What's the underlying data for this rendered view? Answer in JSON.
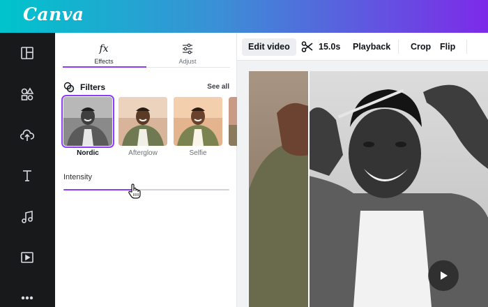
{
  "app": {
    "logo_text": "Canva",
    "brand_gradient": [
      "#00c4cc",
      "#7d2ae8"
    ],
    "accent": "#8b3dff"
  },
  "sidebar": {
    "items": [
      {
        "icon": "layout-icon"
      },
      {
        "icon": "elements-icon"
      },
      {
        "icon": "upload-icon"
      },
      {
        "icon": "text-icon"
      },
      {
        "icon": "music-icon"
      },
      {
        "icon": "video-icon"
      },
      {
        "icon": "more-icon"
      }
    ]
  },
  "panel": {
    "tabs": [
      {
        "glyph": "fx",
        "label": "Effects",
        "active": true
      },
      {
        "glyph": "sliders-icon",
        "label": "Adjust",
        "active": false
      }
    ],
    "filters": {
      "title": "Filters",
      "see_all": "See all",
      "items": [
        {
          "label": "Nordic",
          "selected": true
        },
        {
          "label": "Afterglow",
          "selected": false
        },
        {
          "label": "Selfie",
          "selected": false
        }
      ]
    },
    "intensity": {
      "label": "Intensity",
      "value": 0.42
    }
  },
  "toolbar": {
    "edit_video": "Edit video",
    "duration": "15.0s",
    "playback": "Playback",
    "crop": "Crop",
    "flip": "Flip"
  }
}
